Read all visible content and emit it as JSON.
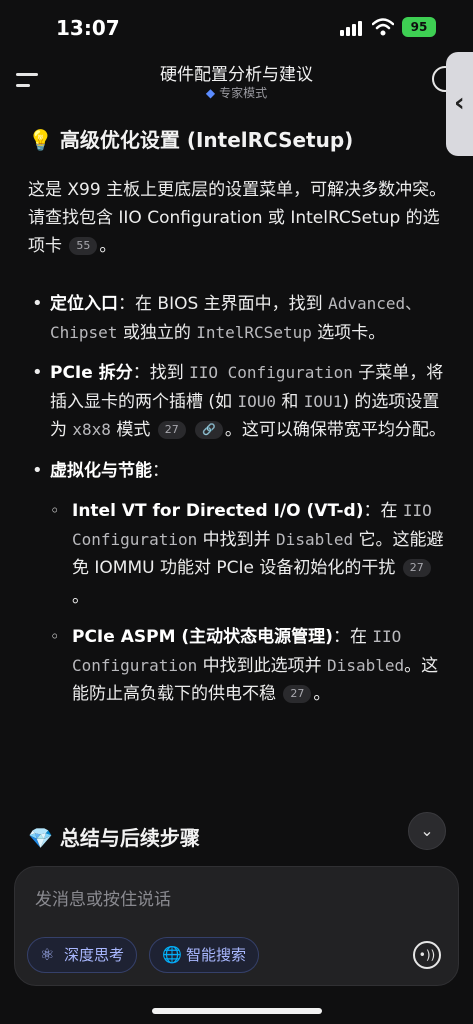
{
  "status": {
    "time": "13:07",
    "battery": "95"
  },
  "header": {
    "title": "硬件配置分析与建议",
    "mode": "专家模式"
  },
  "section1": {
    "title": "高级优化设置 (IntelRCSetup)",
    "intro_a": "这是 X99 主板上更底层的设置菜单，可解决多数冲突。请查找包含 IIO Configuration 或 IntelRCSetup 的选项卡",
    "intro_cite": "55",
    "intro_end": "。"
  },
  "items": {
    "locate": {
      "label": "定位入口",
      "text_a": "：在 BIOS 主界面中，找到 ",
      "code_a": "Advanced、Chipset",
      "text_b": " 或独立的 ",
      "code_b": "IntelRCSetup",
      "text_c": " 选项卡。"
    },
    "pcie": {
      "label": "PCIe 拆分",
      "text_a": "：找到 ",
      "code_a": "IIO Configuration",
      "text_b": " 子菜单，将插入显卡的两个插槽 (如 ",
      "code_b": "IOU0",
      "text_c": " 和 ",
      "code_c": "IOU1",
      "text_d": ") 的选项设置为 ",
      "code_d": "x8x8",
      "text_e": " 模式",
      "cite": "27",
      "text_f": "。这可以确保带宽平均分配。"
    },
    "virt": {
      "label": "虚拟化与节能",
      "text": "："
    },
    "vtd": {
      "label": "Intel VT for Directed I/O (VT-d)",
      "text_a": "：在 ",
      "code_a": "IIO Configuration",
      "text_b": " 中找到并 ",
      "code_b": "Disabled",
      "text_c": " 它。这能避免 IOMMU 功能对 PCIe 设备初始化的干扰",
      "cite": "27",
      "text_d": "。"
    },
    "aspm": {
      "label": "PCIe ASPM (主动状态电源管理)",
      "text_a": "：在 ",
      "code_a": "IIO Configuration",
      "text_b": " 中找到此选项并 ",
      "code_b": "Disabled",
      "text_c": "。这能防止高负载下的供电不稳",
      "cite": "27",
      "text_d": "。"
    }
  },
  "section2": {
    "title": "总结与后续步骤"
  },
  "composer": {
    "placeholder": "发消息或按住说话",
    "deep_think": "深度思考",
    "smart_search": "智能搜索"
  },
  "icons": {
    "opt_title": "lightbulb-icon",
    "sum_title": "diamond-icon",
    "mode": "diamond-icon",
    "accent": "#5b8cff",
    "battery_color": "#3ecf53"
  }
}
